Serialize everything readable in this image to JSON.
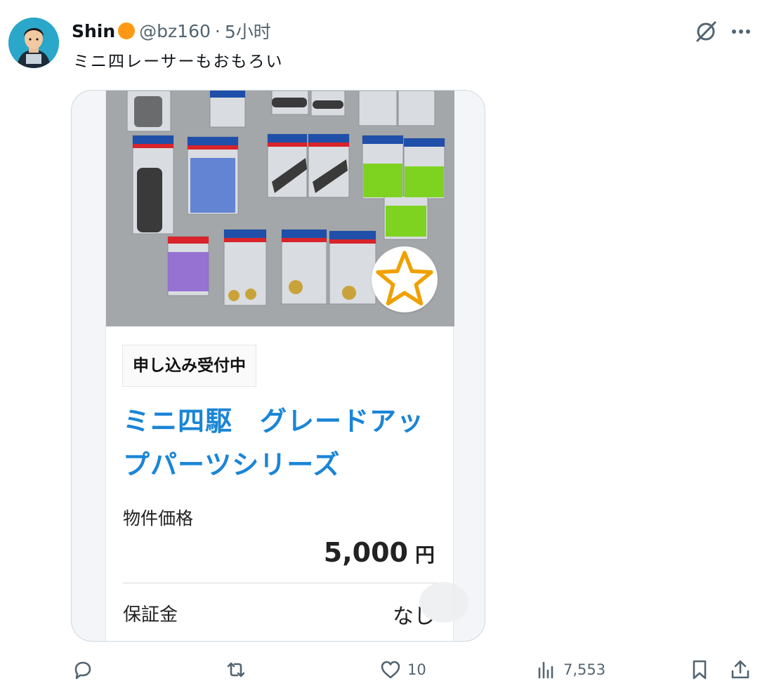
{
  "author": {
    "name": "Shin",
    "handle": "@bz160",
    "separator": "·",
    "time": "5小时",
    "badge_color": "#ff9914"
  },
  "tweet": {
    "text": "ミニ四レーサーもおもろい"
  },
  "card": {
    "status": "申し込み受付中",
    "title": "ミニ四駆　グレードアップパーツシリーズ",
    "price_label": "物件価格",
    "price_value": "5,000",
    "price_unit": "円",
    "deposit_label": "保証金",
    "deposit_value": "なし",
    "favorite_icon": "star-icon"
  },
  "actions": {
    "reply_icon": "reply-icon",
    "retweet_icon": "retweet-icon",
    "like_count": "10",
    "views_count": "7,553",
    "bookmark_icon": "bookmark-icon",
    "share_icon": "share-icon"
  },
  "colors": {
    "title_blue": "#1a85d6",
    "muted": "#536471",
    "star": "#f0a000"
  }
}
